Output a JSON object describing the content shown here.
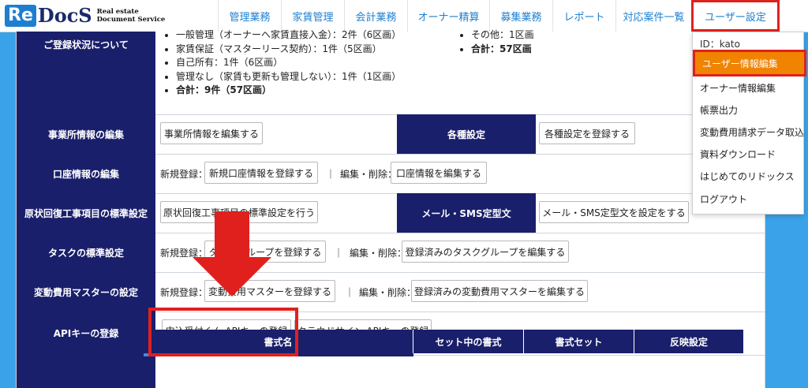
{
  "logo": {
    "mark": "Re",
    "mark2": "DocS",
    "sub_line1": "Real estate",
    "sub_line2": "Document Service"
  },
  "nav": [
    {
      "label": "管理業務"
    },
    {
      "label": "家賃管理"
    },
    {
      "label": "会計業務"
    },
    {
      "label": "オーナー精算"
    },
    {
      "label": "募集業務"
    },
    {
      "label": "レポート"
    },
    {
      "label": "対応案件一覧"
    },
    {
      "label": "ユーザー設定"
    }
  ],
  "registration": {
    "label": "ご登録状況について",
    "left_items": [
      "一般管理（オーナーへ家賃直接入金）：2件（6区画）",
      "家賃保証（マスターリース契約）：1件（5区画）",
      "自己所有：1件（6区画）",
      "管理なし（家賃も更新も管理しない）：1件（1区画）",
      "合計：9件（57区画）"
    ],
    "right_items": [
      "その他：1区画",
      "合計：57区画"
    ]
  },
  "office": {
    "label": "事業所情報の編集",
    "button": "事業所情報を編集する",
    "mid_label": "各種設定",
    "mid_button": "各種設定を登録する"
  },
  "account": {
    "label": "口座情報の編集",
    "new_prefix": "新規登録：",
    "new_button": "新規口座情報を登録する",
    "sep": "｜",
    "edit_prefix": "編集・削除：",
    "edit_button": "口座情報を編集する"
  },
  "restore": {
    "label": "原状回復工事項目の標準設定",
    "button": "原状回復工事項目の標準設定を行う",
    "mid_label": "メール・SMS定型文",
    "mid_button": "メール・SMS定型文を設定をする"
  },
  "task": {
    "label": "タスクの標準設定",
    "new_prefix": "新規登録：",
    "new_button": "タスクグループを登録する",
    "sep": "｜",
    "edit_prefix": "編集・削除：",
    "edit_button": "登録済みのタスクグループを編集する"
  },
  "variable": {
    "label": "変動費用マスターの設定",
    "new_prefix": "新規登録：",
    "new_button": "変動費用マスターを登録する",
    "sep": "｜",
    "edit_prefix": "編集・削除：",
    "edit_button": "登録済みの変動費用マスターを編集する"
  },
  "api": {
    "label": "APIキーの登録",
    "button1": "申込受付くん APIキーの登録",
    "button2": "クラウドサイン APIキーの登録"
  },
  "table": {
    "headers": [
      "書式名",
      "セット中の書式",
      "書式セット",
      "反映設定"
    ]
  },
  "dropdown": {
    "id_text": "ID：kato",
    "items": [
      "ユーザー情報編集",
      "オーナー情報編集",
      "帳票出力",
      "変動費用請求データ取込",
      "資料ダウンロード",
      "はじめてのリドックス",
      "ログアウト"
    ]
  },
  "colors": {
    "navy": "#1a1f6b",
    "accent": "#1e7fd0",
    "highlight": "#f08300",
    "annotation": "#e0201d",
    "background": "#3aa2e8"
  }
}
